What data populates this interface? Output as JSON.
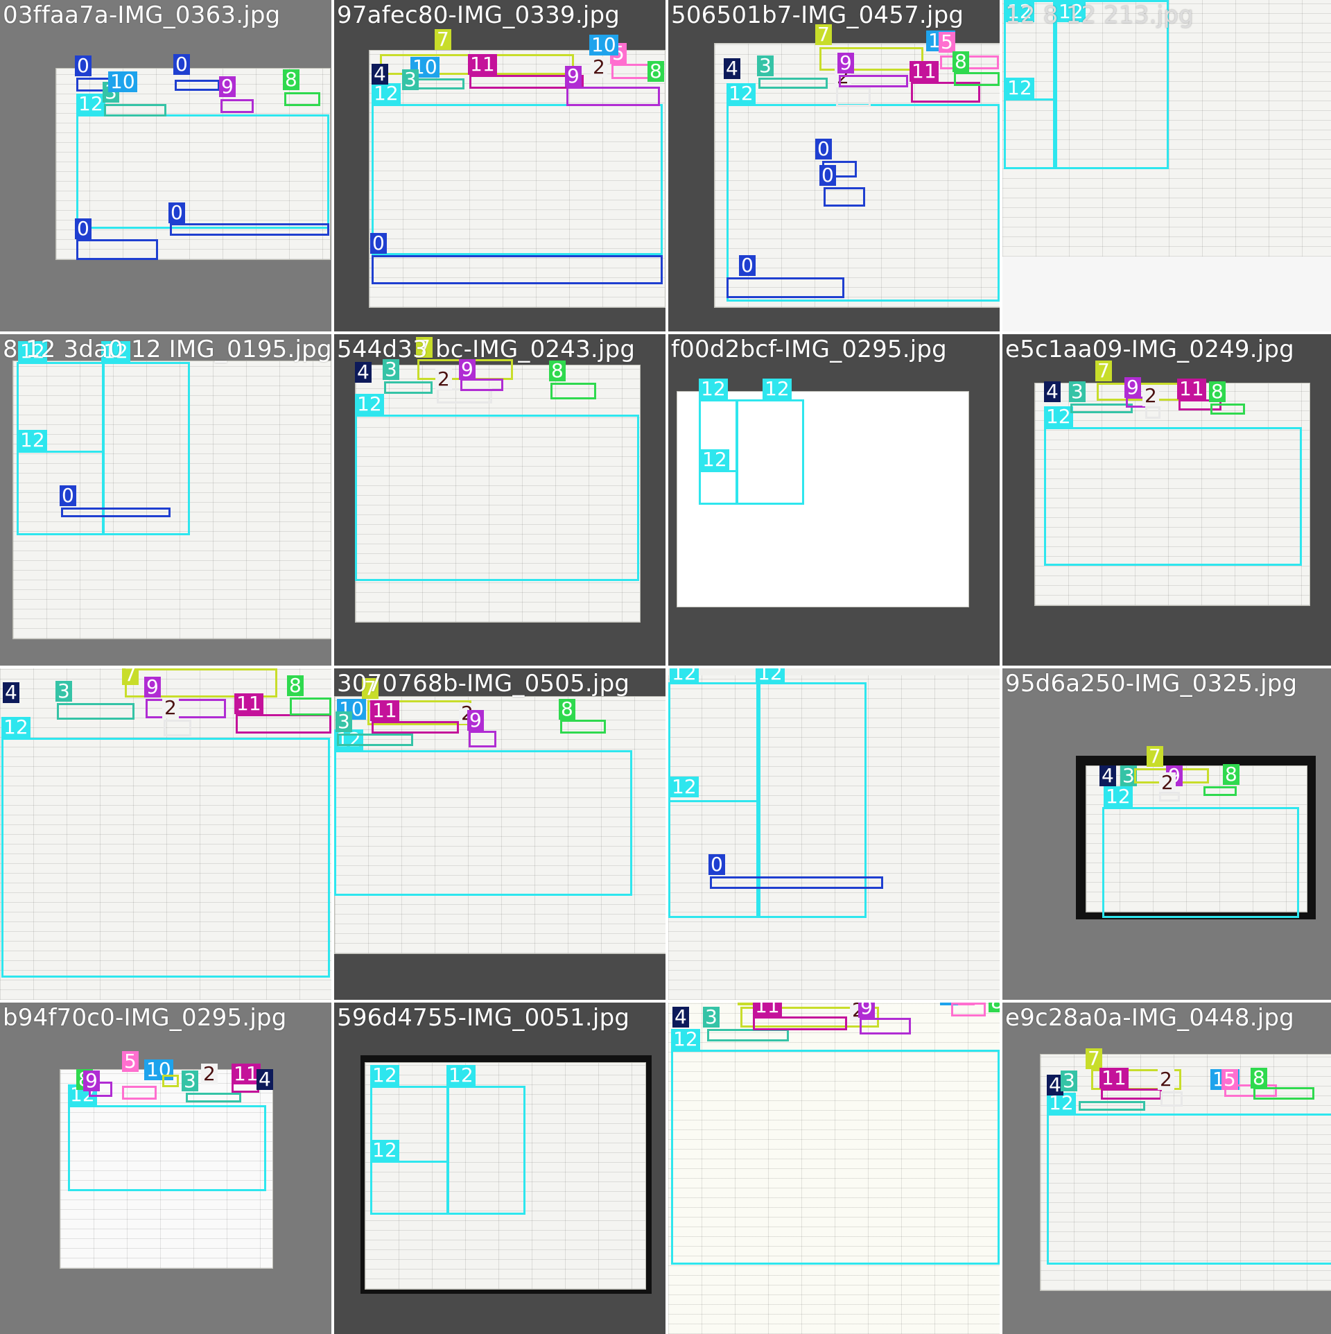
{
  "tiles": [
    {
      "filename": "03ffaa7a-IMG_0363.jpg"
    },
    {
      "filename": "97afec80-IMG_0339.jpg"
    },
    {
      "filename": "506501b7-IMG_0457.jpg"
    },
    {
      "filename": "12 8 12 213.jpg"
    },
    {
      "filename": "8 12 3da0 12 IMG_0195.jpg"
    },
    {
      "filename": "544d33 bc-IMG_0243.jpg"
    },
    {
      "filename": "f00d2bcf-IMG_0295.jpg"
    },
    {
      "filename": "e5c1aa09-IMG_0249.jpg"
    },
    {
      "filename": ""
    },
    {
      "filename": "3070768b-IMG_0505.jpg"
    },
    {
      "filename": ""
    },
    {
      "filename": "95d6a250-IMG_0325.jpg"
    },
    {
      "filename": "b94f70c0-IMG_0295.jpg"
    },
    {
      "filename": "596d4755-IMG_0051.jpg"
    },
    {
      "filename": ""
    },
    {
      "filename": "e9c28a0a-IMG_0448.jpg"
    }
  ],
  "labels": {
    "l0": "0",
    "l2": "2",
    "l3": "3",
    "l4": "4",
    "l5": "5",
    "l7": "7",
    "l8": "8",
    "l9": "9",
    "l10": "10",
    "l11": "11",
    "l12": "12"
  },
  "colors": {
    "class_0": "#1f3fd0",
    "class_2": "#f2f2f2",
    "class_3": "#35c3a6",
    "class_4": "#0d1a5a",
    "class_5": "#ff6fcf",
    "class_7": "#c8dd2a",
    "class_8": "#2fd94e",
    "class_9": "#b02cd3",
    "class_10": "#1ea3ec",
    "class_11": "#c4129a",
    "class_12": "#2ee6ee"
  }
}
